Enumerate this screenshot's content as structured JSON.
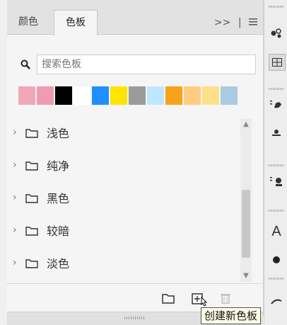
{
  "tabs": [
    {
      "label": "颜色"
    },
    {
      "label": "色板"
    }
  ],
  "tab_controls": {
    "more": ">>",
    "separator": "|"
  },
  "search": {
    "placeholder": "搜索色板"
  },
  "swatches": [
    "#f2a7b8",
    "#ef9bb0",
    "#000000",
    "#ffffff",
    "#1e90ff",
    "#ffe400",
    "#9b9b9b",
    "#bfe6ff",
    "#f7a21b",
    "#ffcc80",
    "#ffe08a",
    "#a9cbe3"
  ],
  "groups": [
    {
      "label": "浅色"
    },
    {
      "label": "纯净"
    },
    {
      "label": "黑色"
    },
    {
      "label": "较暗"
    },
    {
      "label": "淡色"
    }
  ],
  "tooltip": "创建新色板",
  "right_toolbar": {
    "type_label": "A"
  }
}
